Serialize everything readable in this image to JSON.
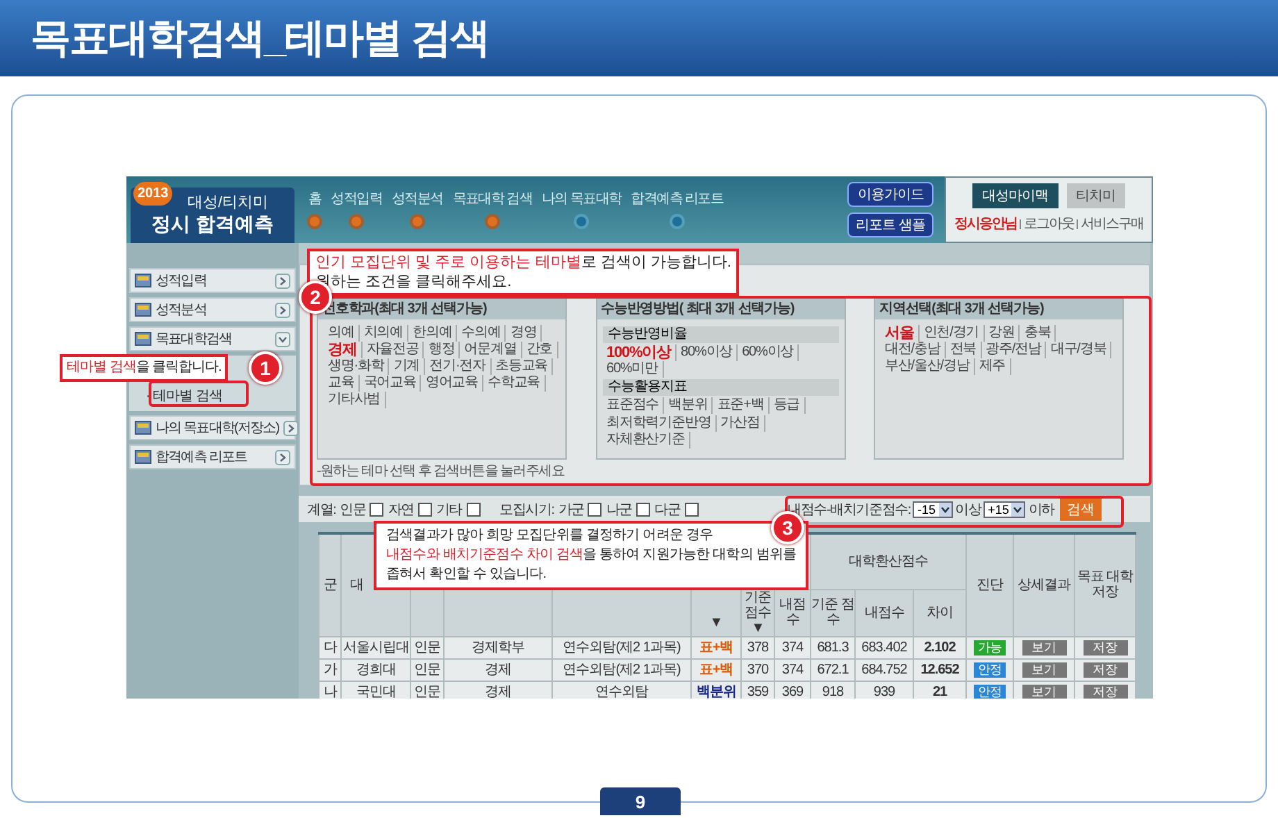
{
  "page_title": "목표대학검색_테마별 검색",
  "app": {
    "logo": {
      "year": "2013",
      "line1": "대성/티치미",
      "line2": "정시 합격예측"
    },
    "steps": [
      {
        "label": "홈",
        "done": true
      },
      {
        "label": "성적입력",
        "done": true
      },
      {
        "label": "성적분석",
        "done": true
      },
      {
        "label": "목표대학 검색",
        "done": true
      },
      {
        "label": "나의 목표대학",
        "done": false
      },
      {
        "label": "합격예측 리포트",
        "done": false
      }
    ],
    "top_buttons": [
      "이용가이드",
      "리포트 샘플"
    ],
    "brand_tabs": [
      {
        "label": "대성마이맥",
        "selected": true
      },
      {
        "label": "티치미",
        "selected": false
      }
    ],
    "user": {
      "name": "정시응안님",
      "links": [
        "로그아웃",
        "서비스구매"
      ]
    },
    "sidebar": [
      {
        "label": "성적입력",
        "expanded": false
      },
      {
        "label": "성적분석",
        "expanded": false
      },
      {
        "label": "목표대학검색",
        "expanded": true,
        "children": [
          {
            "label": "· 테마별 검색"
          }
        ]
      },
      {
        "label": "나의 목표대학(저장소)",
        "expanded": false
      },
      {
        "label": "합격예측 리포트",
        "expanded": false
      }
    ],
    "panels": [
      {
        "title": "선호학과(최대 3개 선택가능)",
        "groups": [
          {
            "options": [
              {
                "label": "의예",
                "selected": false
              },
              {
                "label": "치의예",
                "selected": false
              },
              {
                "label": "한의예",
                "selected": false
              },
              {
                "label": "수의예",
                "selected": false
              },
              {
                "label": "경영",
                "selected": false
              },
              {
                "label": "경제",
                "selected": true
              },
              {
                "label": "자율전공",
                "selected": false
              },
              {
                "label": "행정",
                "selected": false
              },
              {
                "label": "어문계열",
                "selected": false
              },
              {
                "label": "간호",
                "selected": false
              },
              {
                "label": "생명·화학",
                "selected": false
              },
              {
                "label": "기계",
                "selected": false
              },
              {
                "label": "전기·전자",
                "selected": false
              },
              {
                "label": "초등교육",
                "selected": false
              },
              {
                "label": "교육",
                "selected": false
              },
              {
                "label": "국어교육",
                "selected": false
              },
              {
                "label": "영어교육",
                "selected": false
              },
              {
                "label": "수학교육",
                "selected": false
              },
              {
                "label": "기타사범",
                "selected": false
              }
            ]
          }
        ]
      },
      {
        "title": "수능반영방법( 최대 3개 선택가능)",
        "groups": [
          {
            "heading": "수능반영비율",
            "options": [
              {
                "label": "100%이상",
                "selected": true
              },
              {
                "label": "80%이상",
                "selected": false
              },
              {
                "label": "60%이상",
                "selected": false
              },
              {
                "label": "60%미만",
                "selected": false
              }
            ]
          },
          {
            "heading": "수능활용지표",
            "options": [
              {
                "label": "표준점수",
                "selected": false
              },
              {
                "label": "백분위",
                "selected": false
              },
              {
                "label": "표준+백",
                "selected": false
              },
              {
                "label": "등급",
                "selected": false
              }
            ]
          },
          {
            "options": [
              {
                "label": "최저학력기준반영",
                "selected": false
              },
              {
                "label": "가산점",
                "selected": false
              },
              {
                "label": "자체환산기준",
                "selected": false
              }
            ]
          }
        ]
      },
      {
        "title": "지역선택(최대 3개 선택가능)",
        "groups": [
          {
            "options": [
              {
                "label": "서울",
                "selected": true
              },
              {
                "label": "인천/경기",
                "selected": false
              },
              {
                "label": "강원",
                "selected": false
              },
              {
                "label": "충북",
                "selected": false
              },
              {
                "label": "대전/충남",
                "selected": false
              },
              {
                "label": "전북",
                "selected": false
              },
              {
                "label": "광주/전남",
                "selected": false
              },
              {
                "label": "대구/경북",
                "selected": false
              },
              {
                "label": "부산/울산/경남",
                "selected": false
              },
              {
                "label": "제주",
                "selected": false
              }
            ]
          }
        ]
      }
    ],
    "panel_note": "-원하는 테마 선택 후 검색버튼을 눌러주세요",
    "filters": [
      {
        "label": "계열:",
        "options": [
          {
            "label": "인문",
            "checked": false
          },
          {
            "label": "자연",
            "checked": false
          },
          {
            "label": "기타",
            "checked": false
          }
        ]
      },
      {
        "label": "모집시기:",
        "options": [
          {
            "label": "가군",
            "checked": false
          },
          {
            "label": "나군",
            "checked": false
          },
          {
            "label": "다군",
            "checked": false
          }
        ]
      }
    ],
    "score_filter": {
      "label": "내점수-배치기준점수:",
      "min": "-15",
      "min_suffix": "이상",
      "max": "+15",
      "max_suffix": "이하",
      "button": "검색"
    },
    "table": {
      "columns": [
        "군",
        "대",
        "",
        "",
        "",
        "▼",
        "기준 점수 ▼",
        "내점수",
        "기준 점수",
        "내점수",
        "차이",
        "진단",
        "상세결과",
        "목표 대학 저장"
      ],
      "group_header": "대학환산점수",
      "rows": [
        {
          "cells": [
            "다",
            "서울시립대",
            "인문",
            "경제학부",
            "연수외탐(제2 1과목)"
          ],
          "method": {
            "label": "표+백",
            "color": "#e05a00"
          },
          "scores": [
            "378",
            "374",
            "681.3",
            "683.402"
          ],
          "diff": "2.102",
          "status": {
            "label": "가능",
            "color": "#27a830"
          },
          "view": "보기",
          "save": "저장"
        },
        {
          "cells": [
            "가",
            "경희대",
            "인문",
            "경제",
            "연수외탐(제2 1과목)"
          ],
          "method": {
            "label": "표+백",
            "color": "#e05a00"
          },
          "scores": [
            "370",
            "374",
            "672.1",
            "684.752"
          ],
          "diff": "12.652",
          "status": {
            "label": "안정",
            "color": "#2b86d6"
          },
          "view": "보기",
          "save": "저장"
        },
        {
          "cells": [
            "나",
            "국민대",
            "인문",
            "경제",
            "연수외탐"
          ],
          "method": {
            "label": "백분위",
            "color": "#1b2a8a"
          },
          "scores": [
            "359",
            "369",
            "918",
            "939"
          ],
          "diff": "21",
          "status": {
            "label": "안정",
            "color": "#2b86d6"
          },
          "view": "보기",
          "save": "저장"
        }
      ]
    }
  },
  "callouts": [
    {
      "number": "1",
      "lines": [
        [
          {
            "text": "테마별 검색",
            "highlight": true
          },
          {
            "text": "을 클릭합니다.",
            "highlight": false
          }
        ]
      ]
    },
    {
      "number": "2",
      "lines": [
        [
          {
            "text": "인기 모집단위 및 주로 이용하는 테마별",
            "highlight": true
          },
          {
            "text": "로 검색이 가능합니다.",
            "highlight": false
          }
        ],
        [
          {
            "text": "원하는 조건을 클릭해주세요.",
            "highlight": false
          }
        ]
      ]
    },
    {
      "number": "3",
      "lines": [
        [
          {
            "text": "검색결과가 많아 희망 모집단위를 결정하기 어려운 경우",
            "highlight": false
          }
        ],
        [
          {
            "text": "내점수와 배치기준점수 차이 검색",
            "highlight": true
          },
          {
            "text": "을 통하여 지원가능한 대학의 범위를",
            "highlight": false
          }
        ],
        [
          {
            "text": "좁혀서 확인할 수 있습니다.",
            "highlight": false
          }
        ]
      ]
    }
  ],
  "page_number": "9"
}
